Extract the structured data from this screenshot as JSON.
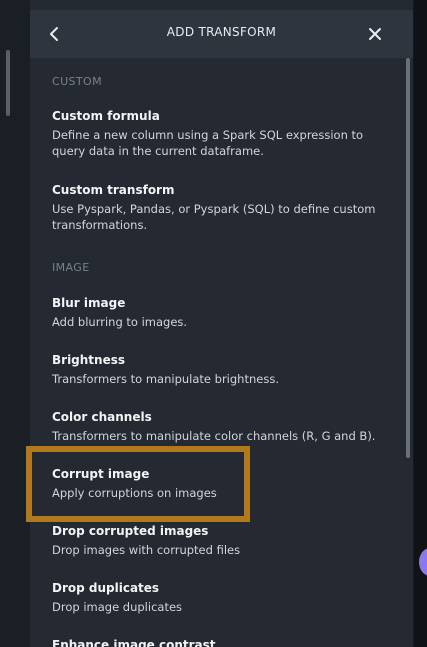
{
  "header": {
    "title": "ADD TRANSFORM"
  },
  "sections": {
    "custom": {
      "heading": "CUSTOM",
      "items": [
        {
          "title": "Custom formula",
          "description": "Define a new column using a Spark SQL expression to query data in the current dataframe."
        },
        {
          "title": "Custom transform",
          "description": "Use Pyspark, Pandas, or Pyspark (SQL) to define custom transformations."
        }
      ]
    },
    "image": {
      "heading": "IMAGE",
      "items": [
        {
          "title": "Blur image",
          "description": "Add blurring to images."
        },
        {
          "title": "Brightness",
          "description": "Transformers to manipulate brightness."
        },
        {
          "title": "Color channels",
          "description": "Transformers to manipulate color channels (R, G and B)."
        },
        {
          "title": "Corrupt image",
          "description": "Apply corruptions on images"
        },
        {
          "title": "Drop corrupted images",
          "description": "Drop images with corrupted files"
        },
        {
          "title": "Drop duplicates",
          "description": "Drop image duplicates"
        },
        {
          "title": "Enhance image contrast",
          "description": ""
        }
      ]
    }
  },
  "highlight": {
    "color": "#b07a1c",
    "target": "Corrupt image"
  },
  "colors": {
    "panel_bg": "#242932",
    "header_bg": "#2f353e",
    "heading_text": "#7a818b",
    "title_text": "#f2f4f6",
    "desc_text": "#d2d6db",
    "accent_purple": "#8a78f0"
  }
}
